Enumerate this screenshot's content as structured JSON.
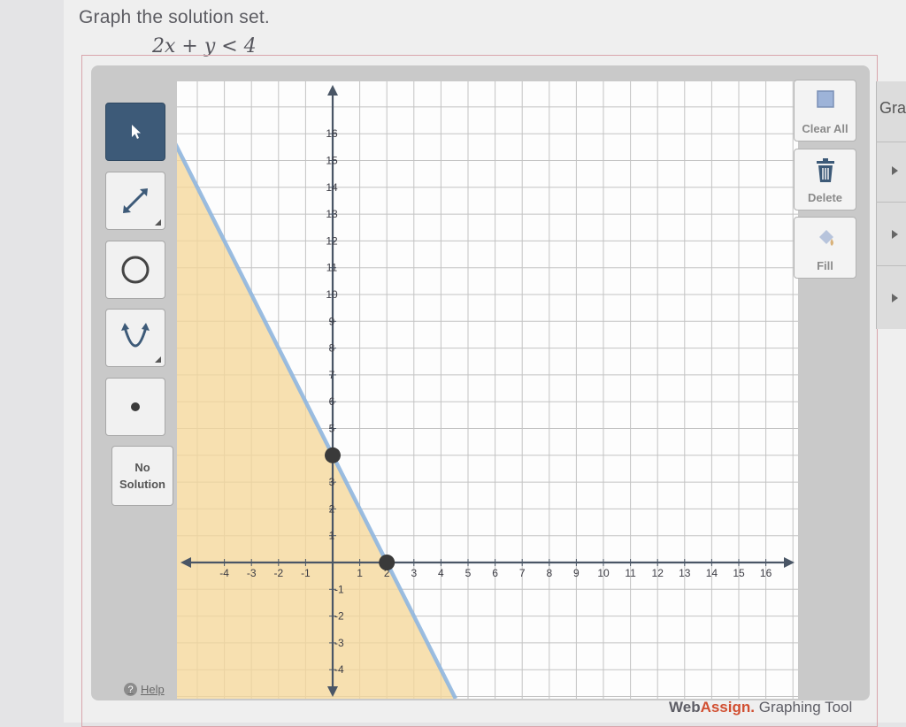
{
  "question": {
    "prompt": "Graph the solution set.",
    "equation": "2x + y < 4"
  },
  "toolbar": {
    "tools": [
      {
        "name": "pointer",
        "icon": "arrow-cursor-icon",
        "active": true
      },
      {
        "name": "line",
        "icon": "line-segment-icon",
        "active": false
      },
      {
        "name": "circle",
        "icon": "circle-icon",
        "active": false
      },
      {
        "name": "parabola",
        "icon": "parabola-icon",
        "active": false
      },
      {
        "name": "point",
        "icon": "point-icon",
        "active": false
      }
    ],
    "no_solution_line1": "No",
    "no_solution_line2": "Solution",
    "help_label": "Help"
  },
  "actions": {
    "clear_all": "Clear All",
    "delete": "Delete",
    "fill": "Fill"
  },
  "right_panel": {
    "title": "Gra"
  },
  "footer": {
    "brand_web": "Web",
    "brand_assign": "Assign.",
    "product": "Graphing Tool"
  },
  "colors": {
    "accent": "#3d5a78",
    "boundary_line": "#8fb6df",
    "fill_region": "#f5d79a",
    "grid": "#c3c3c3",
    "axis": "#4a5666",
    "point": "#3a3a3a"
  },
  "chart_data": {
    "type": "line",
    "xlim": [
      -5,
      17
    ],
    "ylim": [
      -5,
      17
    ],
    "x_ticks": [
      -4,
      -3,
      -2,
      -1,
      1,
      2,
      3,
      4,
      5,
      6,
      7,
      8,
      9,
      10,
      11,
      12,
      13,
      14,
      15,
      16
    ],
    "y_ticks": [
      -4,
      -3,
      -2,
      -1,
      1,
      2,
      3,
      4,
      5,
      6,
      7,
      8,
      9,
      10,
      11,
      12,
      13,
      14,
      15,
      16
    ],
    "x_tick_labels": [
      "-4",
      "-3",
      "-2",
      "-1",
      "1",
      "2",
      "3",
      "4",
      "5",
      "6",
      "7",
      "8",
      "9",
      "10",
      "11",
      "12",
      "13",
      "14",
      "15",
      "16"
    ],
    "y_tick_labels": [
      "-4",
      "-3",
      "-2",
      "-1",
      "1",
      "2",
      "3",
      "4",
      "5",
      "6",
      "7",
      "8",
      "9",
      "10",
      "11",
      "12",
      "13",
      "14",
      "15",
      "16"
    ],
    "grid": true,
    "boundary": {
      "slope": -2,
      "intercept": 4,
      "style": "solid"
    },
    "points": [
      {
        "x": 0,
        "y": 4
      },
      {
        "x": 2,
        "y": 0
      }
    ],
    "shaded_side": "below"
  }
}
